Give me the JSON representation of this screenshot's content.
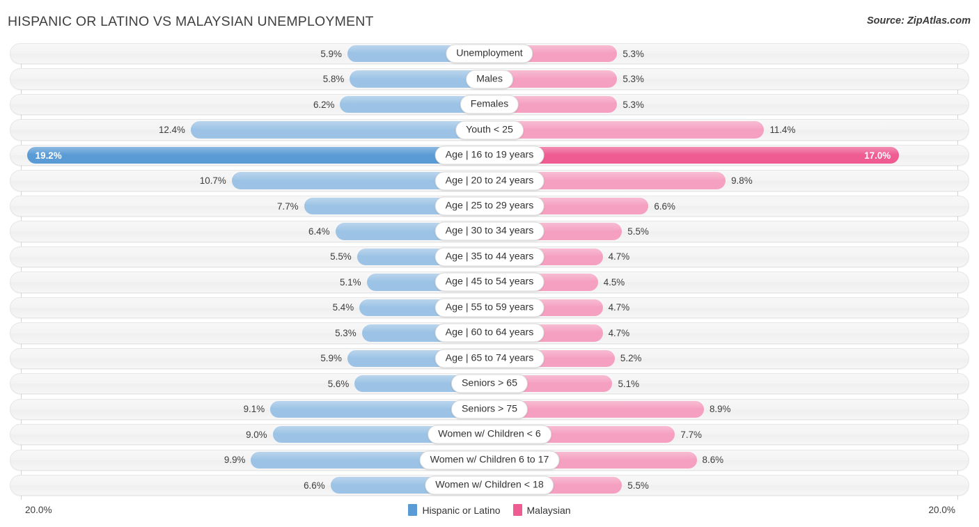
{
  "header": {
    "title": "HISPANIC OR LATINO VS MALAYSIAN UNEMPLOYMENT",
    "source": "Source: ZipAtlas.com"
  },
  "axis": {
    "left_max_label": "20.0%",
    "right_max_label": "20.0%",
    "max_value": 20.0
  },
  "legend": {
    "items": [
      {
        "label": "Hispanic or Latino",
        "color": "#5B9BD5"
      },
      {
        "label": "Malaysian",
        "color": "#EE5C92"
      }
    ]
  },
  "colors": {
    "left_normal": "#9CC3E5",
    "right_normal": "#F5A0C0",
    "left_highlight": "#5B9BD5",
    "right_highlight": "#EE5C92",
    "track": "#F4F4F4",
    "text": "#3D3D3D"
  },
  "chart_data": {
    "type": "bar",
    "subtype": "diverging-bidirectional",
    "title": "HISPANIC OR LATINO VS MALAYSIAN UNEMPLOYMENT",
    "xlabel": "",
    "ylabel": "",
    "xlim": [
      20.0,
      20.0
    ],
    "grid": true,
    "legend_position": "bottom-center",
    "unit": "%",
    "categories": [
      "Unemployment",
      "Males",
      "Females",
      "Youth < 25",
      "Age | 16 to 19 years",
      "Age | 20 to 24 years",
      "Age | 25 to 29 years",
      "Age | 30 to 34 years",
      "Age | 35 to 44 years",
      "Age | 45 to 54 years",
      "Age | 55 to 59 years",
      "Age | 60 to 64 years",
      "Age | 65 to 74 years",
      "Seniors > 65",
      "Seniors > 75",
      "Women w/ Children < 6",
      "Women w/ Children 6 to 17",
      "Women w/ Children < 18"
    ],
    "series": [
      {
        "name": "Hispanic or Latino",
        "side": "left",
        "color": "#9CC3E5",
        "values": [
          5.9,
          5.8,
          6.2,
          12.4,
          19.2,
          10.7,
          7.7,
          6.4,
          5.5,
          5.1,
          5.4,
          5.3,
          5.9,
          5.6,
          9.1,
          9.0,
          9.9,
          6.6
        ],
        "labels": [
          "5.9%",
          "5.8%",
          "6.2%",
          "12.4%",
          "19.2%",
          "10.7%",
          "7.7%",
          "6.4%",
          "5.5%",
          "5.1%",
          "5.4%",
          "5.3%",
          "5.9%",
          "5.6%",
          "9.1%",
          "9.0%",
          "9.9%",
          "6.6%"
        ]
      },
      {
        "name": "Malaysian",
        "side": "right",
        "color": "#F5A0C0",
        "values": [
          5.3,
          5.3,
          5.3,
          11.4,
          17.0,
          9.8,
          6.6,
          5.5,
          4.7,
          4.5,
          4.7,
          4.7,
          5.2,
          5.1,
          8.9,
          7.7,
          8.6,
          5.5
        ],
        "labels": [
          "5.3%",
          "5.3%",
          "5.3%",
          "11.4%",
          "17.0%",
          "9.8%",
          "6.6%",
          "5.5%",
          "4.7%",
          "4.5%",
          "4.7%",
          "4.7%",
          "5.2%",
          "5.1%",
          "8.9%",
          "7.7%",
          "8.6%",
          "5.5%"
        ]
      }
    ],
    "highlight_row_index": 4
  }
}
